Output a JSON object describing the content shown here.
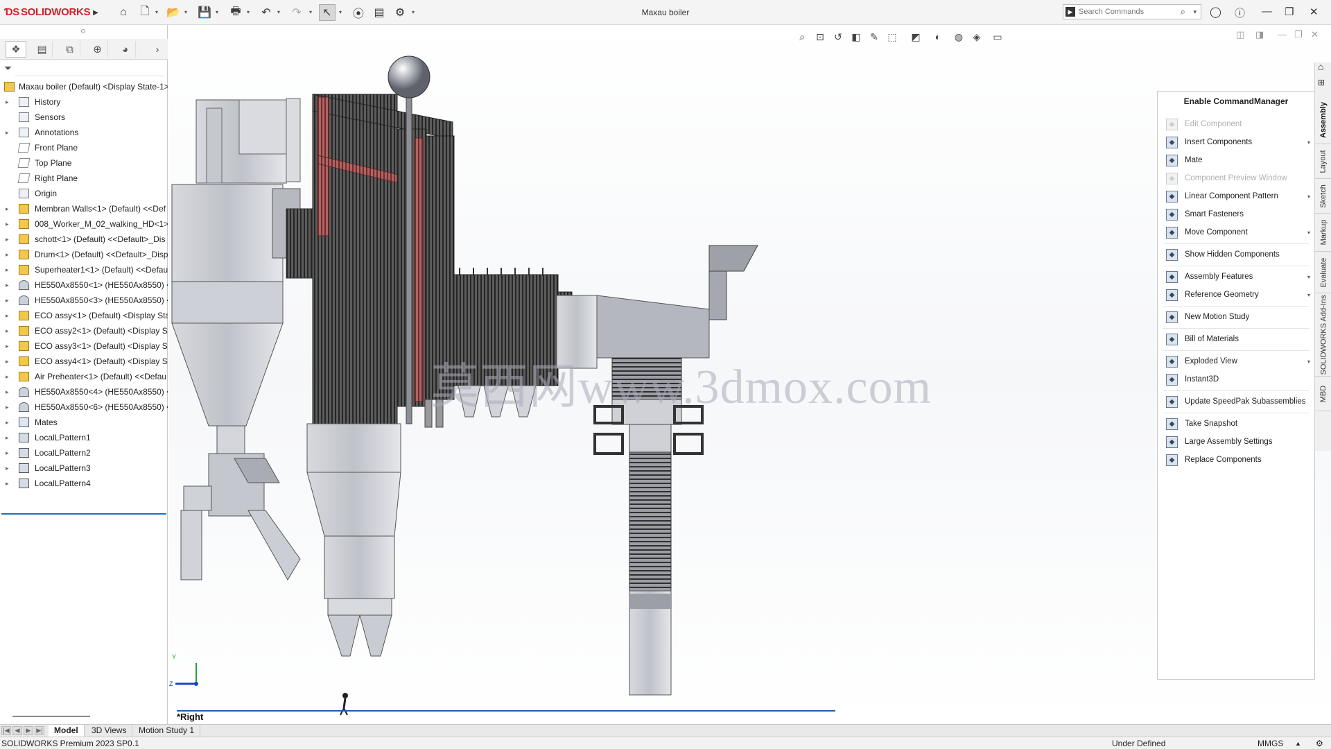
{
  "app": {
    "logo_text": "SOLIDWORKS",
    "window_title": "Maxau boiler",
    "version": "SOLIDWORKS Premium 2023 SP0.1"
  },
  "search": {
    "placeholder": "Search Commands"
  },
  "tree": {
    "root": "Maxau boiler (Default) <Display State-1>",
    "items": [
      {
        "label": "History",
        "icon": "history-icon",
        "expand": true
      },
      {
        "label": "Sensors",
        "icon": "sensor-icon",
        "expand": false
      },
      {
        "label": "Annotations",
        "icon": "annotation-icon",
        "expand": true
      },
      {
        "label": "Front Plane",
        "icon": "plane-icon",
        "expand": false
      },
      {
        "label": "Top Plane",
        "icon": "plane-icon",
        "expand": false
      },
      {
        "label": "Right Plane",
        "icon": "plane-icon",
        "expand": false
      },
      {
        "label": "Origin",
        "icon": "origin-icon",
        "expand": false
      },
      {
        "label": "Membran Walls<1> (Default) <<Def",
        "icon": "assembly-icon",
        "expand": true
      },
      {
        "label": "008_Worker_M_02_walking_HD<1> (",
        "icon": "assembly-icon",
        "expand": true
      },
      {
        "label": "schott<1> (Default) <<Default>_Dis",
        "icon": "assembly-icon",
        "expand": true
      },
      {
        "label": "Drum<1> (Default) <<Default>_Disp",
        "icon": "assembly-icon",
        "expand": true
      },
      {
        "label": "Superheater1<1> (Default) <<Defau",
        "icon": "assembly-icon",
        "expand": true
      },
      {
        "label": "HE550Ax8550<1> (HE550Ax8550) <D",
        "icon": "part-icon",
        "expand": true
      },
      {
        "label": "HE550Ax8550<3> (HE550Ax8550) <D",
        "icon": "part-icon",
        "expand": true
      },
      {
        "label": "ECO assy<1> (Default) <Display Stat",
        "icon": "assembly-icon",
        "expand": true
      },
      {
        "label": "ECO assy2<1> (Default) <Display Sta",
        "icon": "assembly-icon",
        "expand": true
      },
      {
        "label": "ECO assy3<1> (Default) <Display Sta",
        "icon": "assembly-icon",
        "expand": true
      },
      {
        "label": "ECO assy4<1> (Default) <Display Sta",
        "icon": "assembly-icon",
        "expand": true
      },
      {
        "label": "Air Preheater<1> (Default) <<Defau",
        "icon": "assembly-icon",
        "expand": true
      },
      {
        "label": "HE550Ax8550<4> (HE550Ax8550) <D",
        "icon": "part-icon",
        "expand": true
      },
      {
        "label": "HE550Ax8550<6> (HE550Ax8550) <D",
        "icon": "part-icon",
        "expand": true
      },
      {
        "label": "Mates",
        "icon": "mates-icon",
        "expand": true
      },
      {
        "label": "LocalLPattern1",
        "icon": "pattern-icon",
        "expand": true
      },
      {
        "label": "LocalLPattern2",
        "icon": "pattern-icon",
        "expand": true
      },
      {
        "label": "LocalLPattern3",
        "icon": "pattern-icon",
        "expand": true
      },
      {
        "label": "LocalLPattern4",
        "icon": "pattern-icon",
        "expand": true
      }
    ]
  },
  "command_manager": {
    "title": "Enable CommandManager",
    "items": [
      {
        "label": "Edit Component",
        "icon": "edit-component-icon",
        "disabled": true,
        "dropdown": false
      },
      {
        "label": "Insert Components",
        "icon": "insert-components-icon",
        "disabled": false,
        "dropdown": true
      },
      {
        "label": "Mate",
        "icon": "mate-icon",
        "disabled": false,
        "dropdown": false
      },
      {
        "label": "Component Preview Window",
        "icon": "preview-window-icon",
        "disabled": true,
        "dropdown": false
      },
      {
        "label": "Linear Component Pattern",
        "icon": "linear-pattern-icon",
        "disabled": false,
        "dropdown": true
      },
      {
        "label": "Smart Fasteners",
        "icon": "smart-fasteners-icon",
        "disabled": false,
        "dropdown": false
      },
      {
        "label": "Move Component",
        "icon": "move-component-icon",
        "disabled": false,
        "dropdown": true
      },
      {
        "label": "Show Hidden Components",
        "icon": "show-hidden-icon",
        "disabled": false,
        "dropdown": false
      },
      {
        "label": "Assembly Features",
        "icon": "assembly-features-icon",
        "disabled": false,
        "dropdown": true
      },
      {
        "label": "Reference Geometry",
        "icon": "reference-geometry-icon",
        "disabled": false,
        "dropdown": true
      },
      {
        "label": "New Motion Study",
        "icon": "motion-study-icon",
        "disabled": false,
        "dropdown": false
      },
      {
        "label": "Bill of Materials",
        "icon": "bom-icon",
        "disabled": false,
        "dropdown": false
      },
      {
        "label": "Exploded View",
        "icon": "exploded-view-icon",
        "disabled": false,
        "dropdown": true
      },
      {
        "label": "Instant3D",
        "icon": "instant3d-icon",
        "disabled": false,
        "dropdown": false
      },
      {
        "label": "Update SpeedPak Subassemblies",
        "icon": "speedpak-icon",
        "disabled": false,
        "dropdown": false
      },
      {
        "label": "Take Snapshot",
        "icon": "snapshot-icon",
        "disabled": false,
        "dropdown": false
      },
      {
        "label": "Large Assembly Settings",
        "icon": "large-assembly-icon",
        "disabled": false,
        "dropdown": false
      },
      {
        "label": "Replace Components",
        "icon": "replace-components-icon",
        "disabled": false,
        "dropdown": false
      }
    ]
  },
  "side_tabs": [
    "Assembly",
    "Layout",
    "Sketch",
    "Markup",
    "Evaluate",
    "SOLIDWORKS Add-Ins",
    "MBD"
  ],
  "bottom_tabs": [
    "Model",
    "3D Views",
    "Motion Study 1"
  ],
  "viewport": {
    "view_name": "*Right",
    "watermark": "莫西网www.3dmox.com",
    "axis_y": "Y",
    "axis_z": "Z"
  },
  "status": {
    "state": "Under Defined",
    "units": "MMGS"
  },
  "colors": {
    "accent": "#1f6fb4",
    "brand": "#d31f2a",
    "tube_red": "#a85050",
    "tube_dark": "#3c3c3c",
    "steel": "#c8cad0"
  }
}
